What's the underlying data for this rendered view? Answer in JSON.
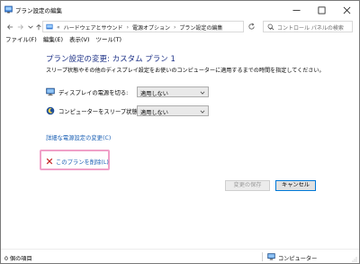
{
  "window": {
    "title": "プラン設定の編集"
  },
  "address": {
    "breadcrumbs": [
      "ハードウェアとサウンド",
      "電源オプション",
      "プラン設定の編集"
    ],
    "separator": "›",
    "overflow": "«",
    "search_placeholder": "コントロール パネルの検索"
  },
  "menubar": {
    "items": [
      "ファイル(F)",
      "編集(E)",
      "表示(V)",
      "ツール(T)"
    ]
  },
  "main": {
    "heading": "プラン設定の変更: カスタム プラン 1",
    "description": "スリープ状態やその他のディスプレイ設定をお使いのコンピューターに適用するまでの時間を指定してください。",
    "display_off_label": "ディスプレイの電源を切る:",
    "display_off_value": "適用しない",
    "sleep_label": "コンピューターをスリープ状態にする:",
    "sleep_value": "適用しない",
    "advanced_link": "詳細な電源設定の変更(C)",
    "delete_link": "このプランを削除(L)",
    "save_button": "変更の保存",
    "cancel_button": "キャンセル"
  },
  "status": {
    "items_count": "0 個の項目",
    "location": "コンピューター"
  },
  "colors": {
    "heading": "#1e3287",
    "link": "#1a5fb4",
    "highlight": "#f0a0c8"
  }
}
